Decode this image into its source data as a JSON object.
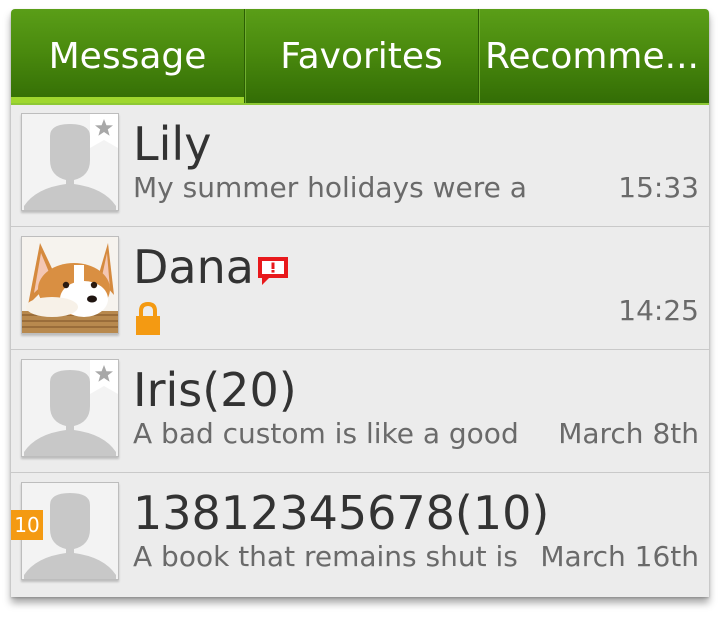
{
  "tabs": [
    {
      "label": "Message",
      "active": true
    },
    {
      "label": "Favorites",
      "active": false
    },
    {
      "label": "Recomme..."
    }
  ],
  "conversations": [
    {
      "name": "Lily",
      "preview": "My summer holidays were a",
      "time": "15:33",
      "starred": true,
      "avatar": "default-avatar"
    },
    {
      "name": "Dana",
      "preview": "",
      "time": "14:25",
      "avatar": "corgi-photo",
      "alert_icon": "alert-icon",
      "locked": true
    },
    {
      "name": "Iris(20)",
      "preview": "A bad custom is like a good",
      "time": "March 8th",
      "starred": true,
      "avatar": "default-avatar"
    },
    {
      "name": "13812345678(10)",
      "preview": "A book that remains shut is",
      "time": "March 16th",
      "unread_count": "10",
      "avatar": "default-avatar"
    }
  ],
  "colors": {
    "tab_bar": "#4a8a0e",
    "tab_indicator": "#9fd72e",
    "list_bg": "#ececec",
    "alert": "#e8191c",
    "badge": "#f49a12"
  }
}
